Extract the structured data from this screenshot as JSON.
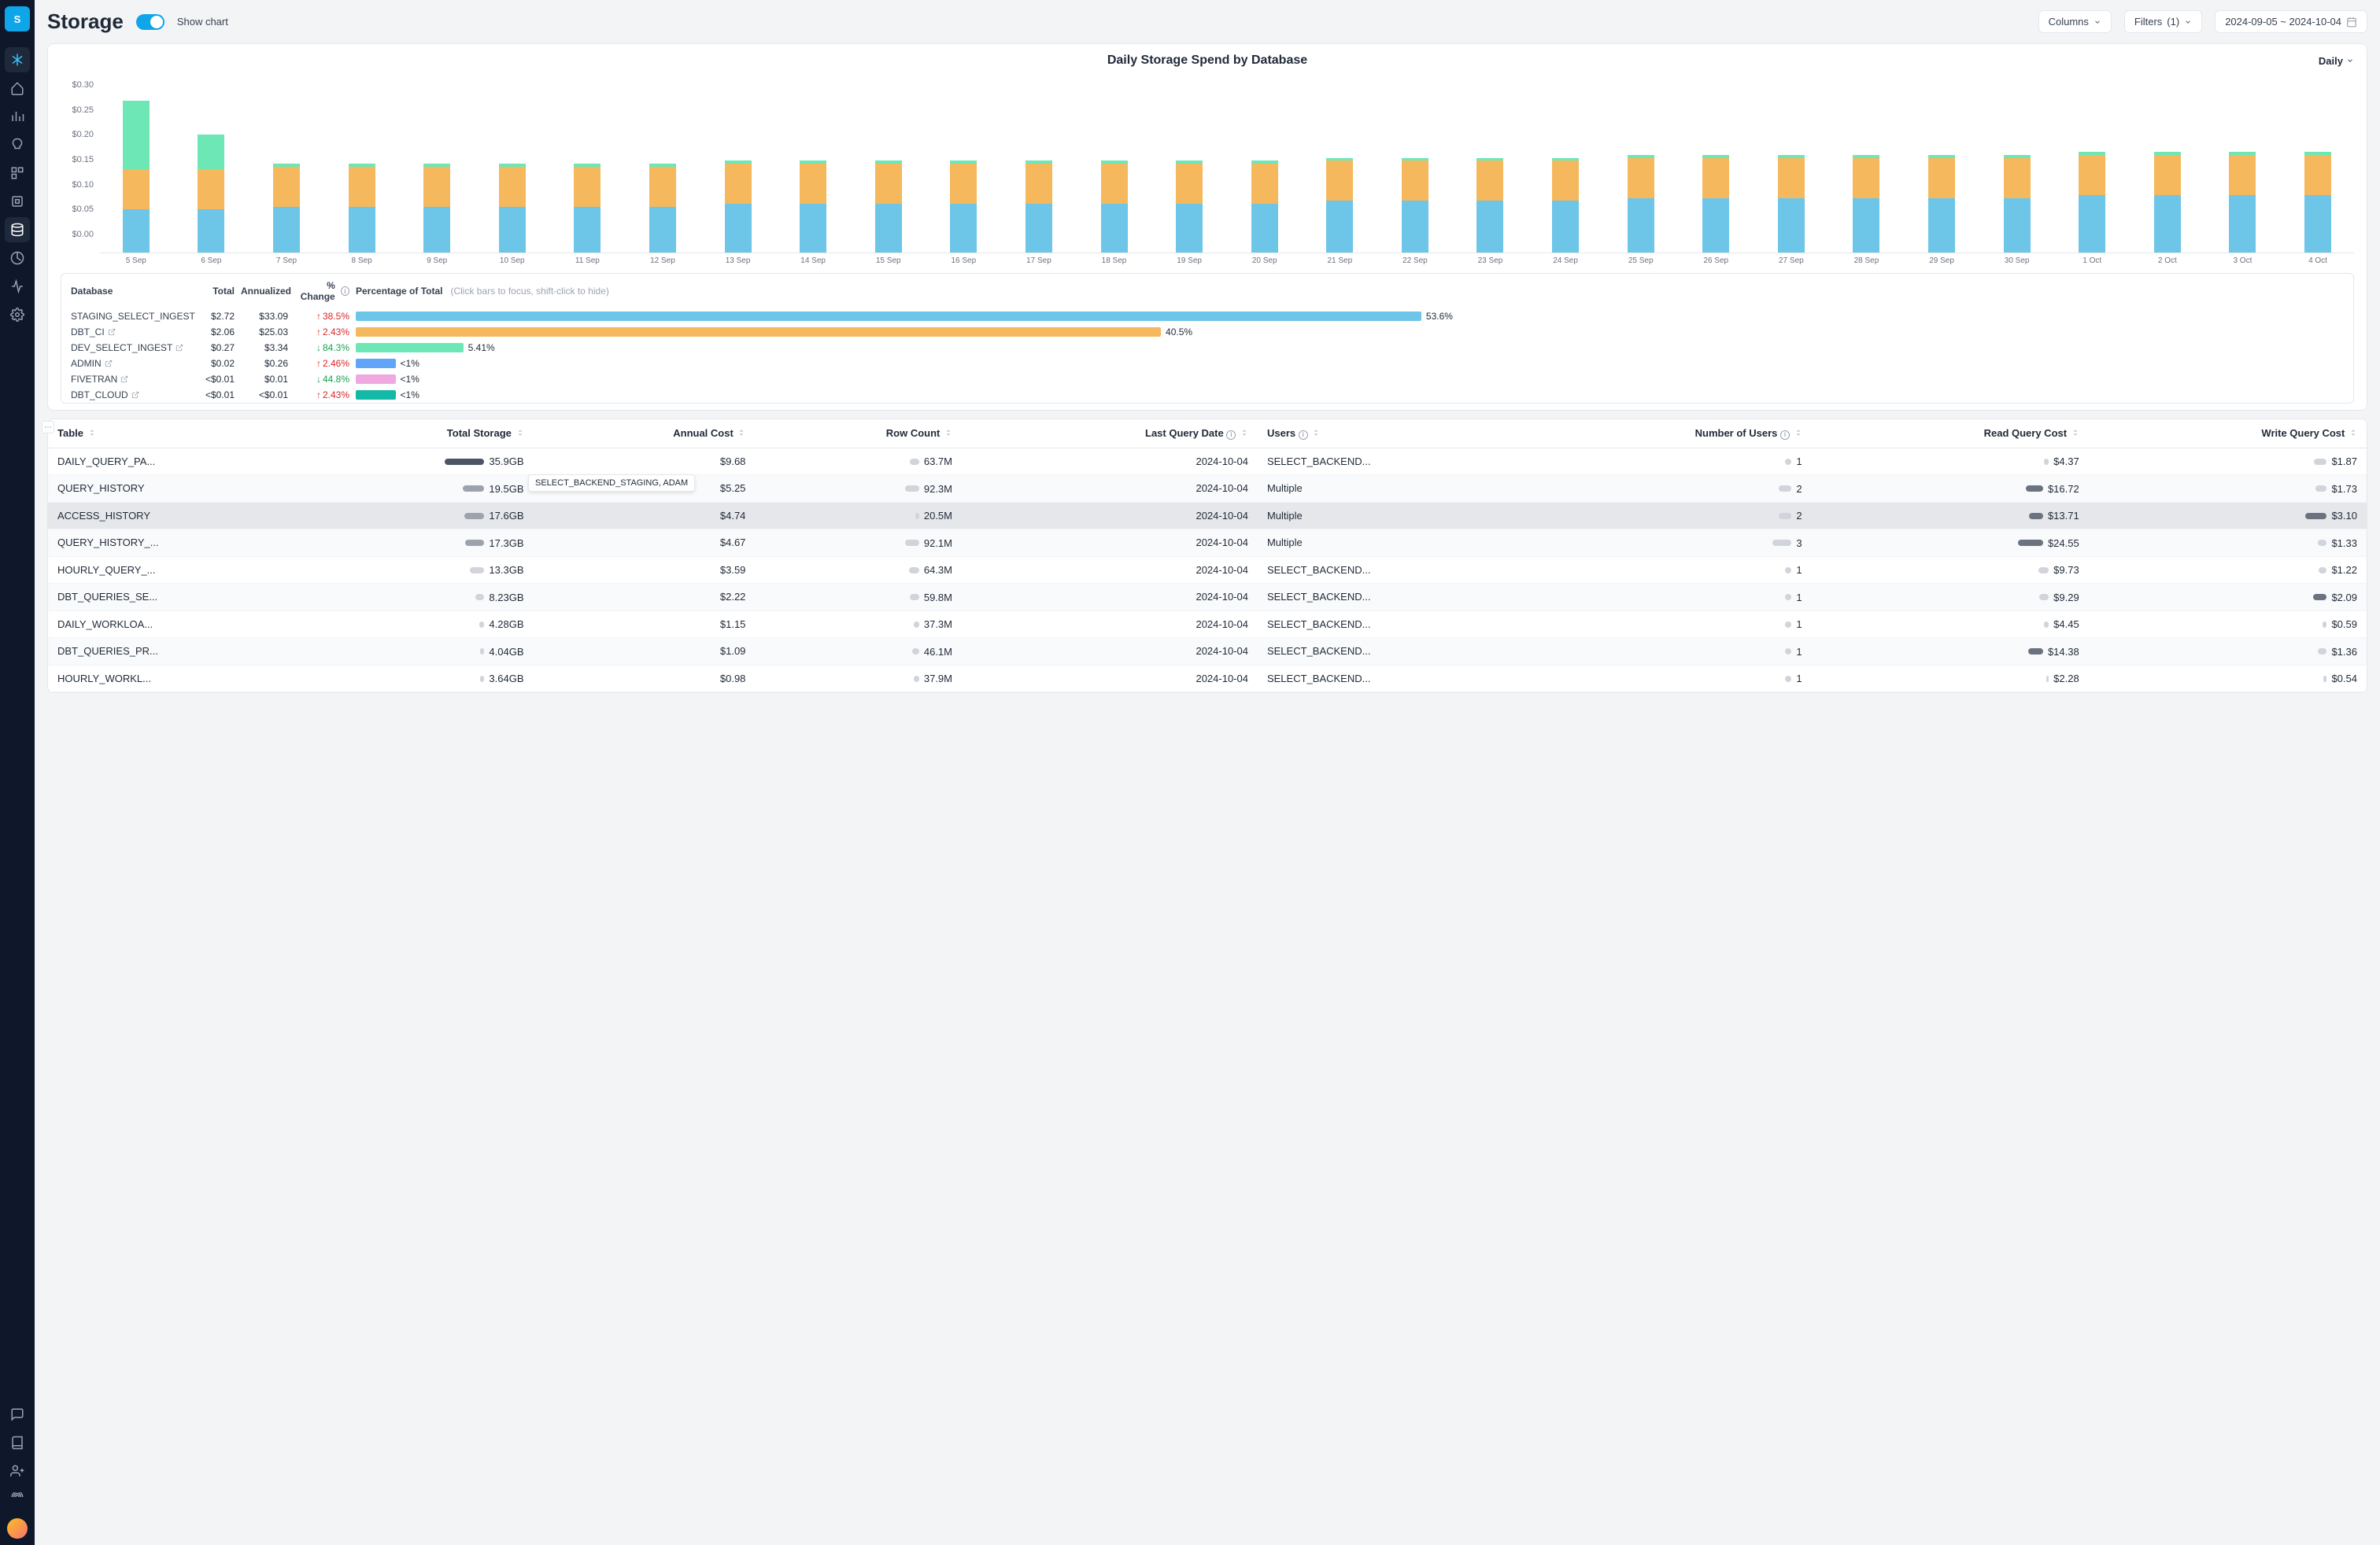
{
  "page": {
    "title": "Storage",
    "toggleLabel": "Show chart"
  },
  "header": {
    "columnsLabel": "Columns",
    "filtersLabel": "Filters",
    "filterCount": "(1)",
    "dateRange": "2024-09-05 ~ 2024-10-04"
  },
  "chart": {
    "title": "Daily Storage Spend by Database",
    "granularity": "Daily"
  },
  "chart_data": {
    "type": "bar",
    "stacked": true,
    "title": "Daily Storage Spend by Database",
    "xlabel": "",
    "ylabel": "$",
    "ylim": [
      0,
      0.3
    ],
    "yticks": [
      "$0.30",
      "$0.25",
      "$0.20",
      "$0.15",
      "$0.10",
      "$0.05",
      "$0.00"
    ],
    "categories": [
      "5 Sep",
      "6 Sep",
      "7 Sep",
      "8 Sep",
      "9 Sep",
      "10 Sep",
      "11 Sep",
      "12 Sep",
      "13 Sep",
      "14 Sep",
      "15 Sep",
      "16 Sep",
      "17 Sep",
      "18 Sep",
      "19 Sep",
      "20 Sep",
      "21 Sep",
      "22 Sep",
      "23 Sep",
      "24 Sep",
      "25 Sep",
      "26 Sep",
      "27 Sep",
      "28 Sep",
      "29 Sep",
      "30 Sep",
      "1 Oct",
      "2 Oct",
      "3 Oct",
      "4 Oct"
    ],
    "series": [
      {
        "name": "STAGING_SELECT_INGEST",
        "color": "#6dc5e8",
        "values": [
          0.075,
          0.075,
          0.08,
          0.08,
          0.08,
          0.08,
          0.08,
          0.08,
          0.085,
          0.085,
          0.085,
          0.085,
          0.085,
          0.085,
          0.085,
          0.085,
          0.09,
          0.09,
          0.09,
          0.09,
          0.095,
          0.095,
          0.095,
          0.095,
          0.095,
          0.095,
          0.1,
          0.1,
          0.1,
          0.1
        ]
      },
      {
        "name": "DBT_CI",
        "color": "#f5b85c",
        "values": [
          0.07,
          0.07,
          0.07,
          0.07,
          0.07,
          0.07,
          0.07,
          0.07,
          0.07,
          0.07,
          0.07,
          0.07,
          0.07,
          0.07,
          0.07,
          0.07,
          0.07,
          0.07,
          0.07,
          0.07,
          0.07,
          0.07,
          0.07,
          0.07,
          0.07,
          0.07,
          0.07,
          0.07,
          0.07,
          0.07
        ]
      },
      {
        "name": "DEV_SELECT_INGEST",
        "color": "#6ee7b7",
        "values": [
          0.12,
          0.06,
          0.005,
          0.005,
          0.005,
          0.005,
          0.005,
          0.005,
          0.005,
          0.005,
          0.005,
          0.005,
          0.005,
          0.005,
          0.005,
          0.005,
          0.005,
          0.005,
          0.005,
          0.005,
          0.005,
          0.005,
          0.005,
          0.005,
          0.005,
          0.005,
          0.005,
          0.005,
          0.005,
          0.005
        ]
      },
      {
        "name": "ADMIN",
        "color": "#60a5fa",
        "values": [
          0,
          0,
          0,
          0,
          0,
          0,
          0,
          0,
          0,
          0,
          0,
          0,
          0,
          0,
          0,
          0,
          0,
          0,
          0,
          0,
          0,
          0,
          0,
          0,
          0,
          0,
          0,
          0,
          0,
          0
        ]
      },
      {
        "name": "FIVETRAN",
        "color": "#f0a9e0",
        "values": [
          0,
          0,
          0,
          0,
          0,
          0,
          0,
          0,
          0,
          0,
          0,
          0,
          0,
          0,
          0,
          0,
          0,
          0,
          0,
          0,
          0,
          0,
          0,
          0,
          0,
          0,
          0,
          0,
          0,
          0
        ]
      },
      {
        "name": "DBT_CLOUD",
        "color": "#14b8a6",
        "values": [
          0,
          0,
          0,
          0,
          0,
          0,
          0,
          0,
          0,
          0,
          0,
          0,
          0,
          0,
          0,
          0,
          0,
          0,
          0,
          0,
          0,
          0,
          0,
          0,
          0,
          0,
          0,
          0,
          0,
          0
        ]
      }
    ]
  },
  "legend": {
    "headers": {
      "database": "Database",
      "total": "Total",
      "annualized": "Annualized",
      "change": "% Change",
      "pct": "Percentage of Total",
      "hint": "(Click bars to focus, shift-click to hide)"
    },
    "rows": [
      {
        "db": "STAGING_SELECT_INGEST",
        "total": "$2.72",
        "ann": "$33.09",
        "chg": "38.5%",
        "dir": "up",
        "pct": "53.6%",
        "w": 53.6,
        "color": "#6dc5e8"
      },
      {
        "db": "DBT_CI",
        "total": "$2.06",
        "ann": "$25.03",
        "chg": "2.43%",
        "dir": "up",
        "pct": "40.5%",
        "w": 40.5,
        "color": "#f5b85c"
      },
      {
        "db": "DEV_SELECT_INGEST",
        "total": "$0.27",
        "ann": "$3.34",
        "chg": "84.3%",
        "dir": "down",
        "pct": "5.41%",
        "w": 5.41,
        "color": "#6ee7b7"
      },
      {
        "db": "ADMIN",
        "total": "$0.02",
        "ann": "$0.26",
        "chg": "2.46%",
        "dir": "up",
        "pct": "<1%",
        "w": 2,
        "color": "#60a5fa"
      },
      {
        "db": "FIVETRAN",
        "total": "<$0.01",
        "ann": "$0.01",
        "chg": "44.8%",
        "dir": "down",
        "pct": "<1%",
        "w": 2,
        "color": "#f0a9e0"
      },
      {
        "db": "DBT_CLOUD",
        "total": "<$0.01",
        "ann": "<$0.01",
        "chg": "2.43%",
        "dir": "up",
        "pct": "<1%",
        "w": 2,
        "color": "#14b8a6"
      }
    ]
  },
  "tooltip": "SELECT_BACKEND_STAGING, ADAM",
  "table": {
    "headers": {
      "table": "Table",
      "storage": "Total Storage",
      "cost": "Annual Cost",
      "rows": "Row Count",
      "date": "Last Query Date",
      "users": "Users",
      "nusers": "Number of Users",
      "rcost": "Read Query Cost",
      "wcost": "Write Query Cost"
    },
    "rows": [
      {
        "table": "DAILY_QUERY_PA...",
        "storage": "35.9GB",
        "sw": 100,
        "sc": "dark",
        "cost": "$9.68",
        "rows": "63.7M",
        "rw": 30,
        "date": "2024-10-04",
        "users": "SELECT_BACKEND...",
        "nusers": "1",
        "nw": 8,
        "rcost": "$4.37",
        "rcw": 15,
        "wcost": "$1.87",
        "wcw": 40
      },
      {
        "table": "QUERY_HISTORY",
        "storage": "19.5GB",
        "sw": 55,
        "sc": "med",
        "cost": "$5.25",
        "rows": "92.3M",
        "rw": 45,
        "date": "2024-10-04",
        "users": "Multiple",
        "nusers": "2",
        "nw": 16,
        "rcost": "$16.72",
        "rcw": 55,
        "wcost": "$1.73",
        "wcw": 35
      },
      {
        "table": "ACCESS_HISTORY",
        "storage": "17.6GB",
        "sw": 50,
        "sc": "med",
        "cost": "$4.74",
        "rows": "20.5M",
        "rw": 12,
        "date": "2024-10-04",
        "users": "Multiple",
        "nusers": "2",
        "nw": 16,
        "rcost": "$13.71",
        "rcw": 45,
        "wcost": "$3.10",
        "wcw": 68,
        "hover": true
      },
      {
        "table": "QUERY_HISTORY_...",
        "storage": "17.3GB",
        "sw": 48,
        "sc": "med",
        "cost": "$4.67",
        "rows": "92.1M",
        "rw": 45,
        "date": "2024-10-04",
        "users": "Multiple",
        "nusers": "3",
        "nw": 24,
        "rcost": "$24.55",
        "rcw": 80,
        "wcost": "$1.33",
        "wcw": 28
      },
      {
        "table": "HOURLY_QUERY_...",
        "storage": "13.3GB",
        "sw": 37,
        "sc": "light",
        "cost": "$3.59",
        "rows": "64.3M",
        "rw": 31,
        "date": "2024-10-04",
        "users": "SELECT_BACKEND...",
        "nusers": "1",
        "nw": 8,
        "rcost": "$9.73",
        "rcw": 32,
        "wcost": "$1.22",
        "wcw": 26
      },
      {
        "table": "DBT_QUERIES_SE...",
        "storage": "8.23GB",
        "sw": 23,
        "sc": "light",
        "cost": "$2.22",
        "rows": "59.8M",
        "rw": 29,
        "date": "2024-10-04",
        "users": "SELECT_BACKEND...",
        "nusers": "1",
        "nw": 8,
        "rcost": "$9.29",
        "rcw": 31,
        "wcost": "$2.09",
        "wcw": 44
      },
      {
        "table": "DAILY_WORKLOA...",
        "storage": "4.28GB",
        "sw": 12,
        "sc": "light",
        "cost": "$1.15",
        "rows": "37.3M",
        "rw": 18,
        "date": "2024-10-04",
        "users": "SELECT_BACKEND...",
        "nusers": "1",
        "nw": 8,
        "rcost": "$4.45",
        "rcw": 15,
        "wcost": "$0.59",
        "wcw": 13
      },
      {
        "table": "DBT_QUERIES_PR...",
        "storage": "4.04GB",
        "sw": 11,
        "sc": "light",
        "cost": "$1.09",
        "rows": "46.1M",
        "rw": 22,
        "date": "2024-10-04",
        "users": "SELECT_BACKEND...",
        "nusers": "1",
        "nw": 8,
        "rcost": "$14.38",
        "rcw": 48,
        "wcost": "$1.36",
        "wcw": 29
      },
      {
        "table": "HOURLY_WORKL...",
        "storage": "3.64GB",
        "sw": 10,
        "sc": "light",
        "cost": "$0.98",
        "rows": "37.9M",
        "rw": 18,
        "date": "2024-10-04",
        "users": "SELECT_BACKEND...",
        "nusers": "1",
        "nw": 8,
        "rcost": "$2.28",
        "rcw": 8,
        "wcost": "$0.54",
        "wcw": 12
      }
    ]
  }
}
